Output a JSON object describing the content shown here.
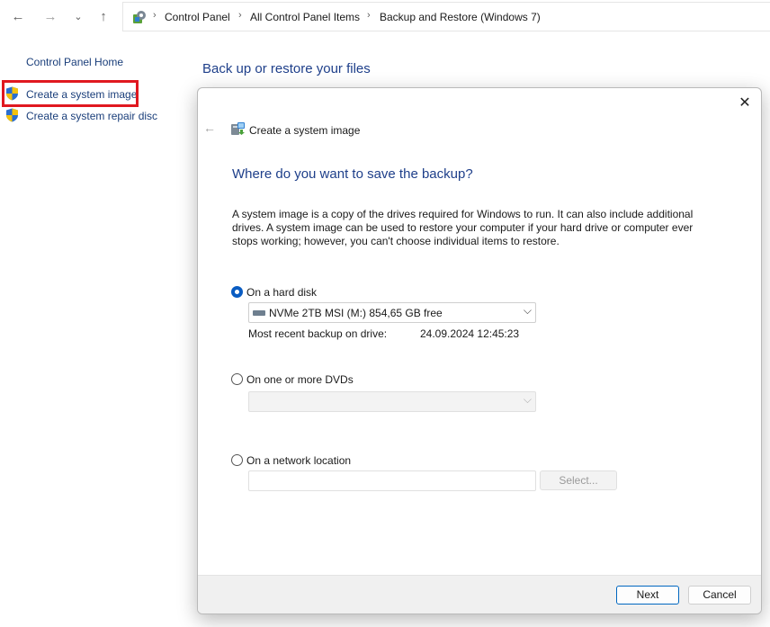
{
  "nav": {
    "back_icon": "←",
    "forward_icon": "→",
    "recent_icon": "⌄",
    "up_icon": "↑",
    "separator": "›",
    "breadcrumbs": [
      "Control Panel",
      "All Control Panel Items",
      "Backup and Restore (Windows 7)"
    ]
  },
  "sidebar": {
    "home": "Control Panel Home",
    "links": [
      "Create a system image",
      "Create a system repair disc"
    ]
  },
  "main": {
    "heading": "Back up or restore your files"
  },
  "dialog": {
    "close_icon": "✕",
    "back_icon": "←",
    "title": "Create a system image",
    "heading": "Where do you want to save the backup?",
    "description": "A system image is a copy of the drives required for Windows to run. It can also include additional drives. A system image can be used to restore your computer if your hard drive or computer ever stops working; however, you can't choose individual items to restore.",
    "options": {
      "hard_disk": {
        "label": "On a hard disk",
        "selected": true,
        "drive": "NVMe 2TB MSI (M:)  854,65 GB free",
        "recent_label": "Most recent backup on drive:",
        "recent_value": "24.09.2024 12:45:23"
      },
      "dvd": {
        "label": "On one or more DVDs",
        "selected": false,
        "drive": ""
      },
      "network": {
        "label": "On a network location",
        "selected": false,
        "path": "",
        "select_button": "Select..."
      }
    },
    "buttons": {
      "next": "Next",
      "cancel": "Cancel"
    }
  },
  "colors": {
    "link": "#1a3e7a",
    "heading": "#1e3f8a",
    "highlight_border": "#e01820",
    "accent": "#0067c0"
  }
}
